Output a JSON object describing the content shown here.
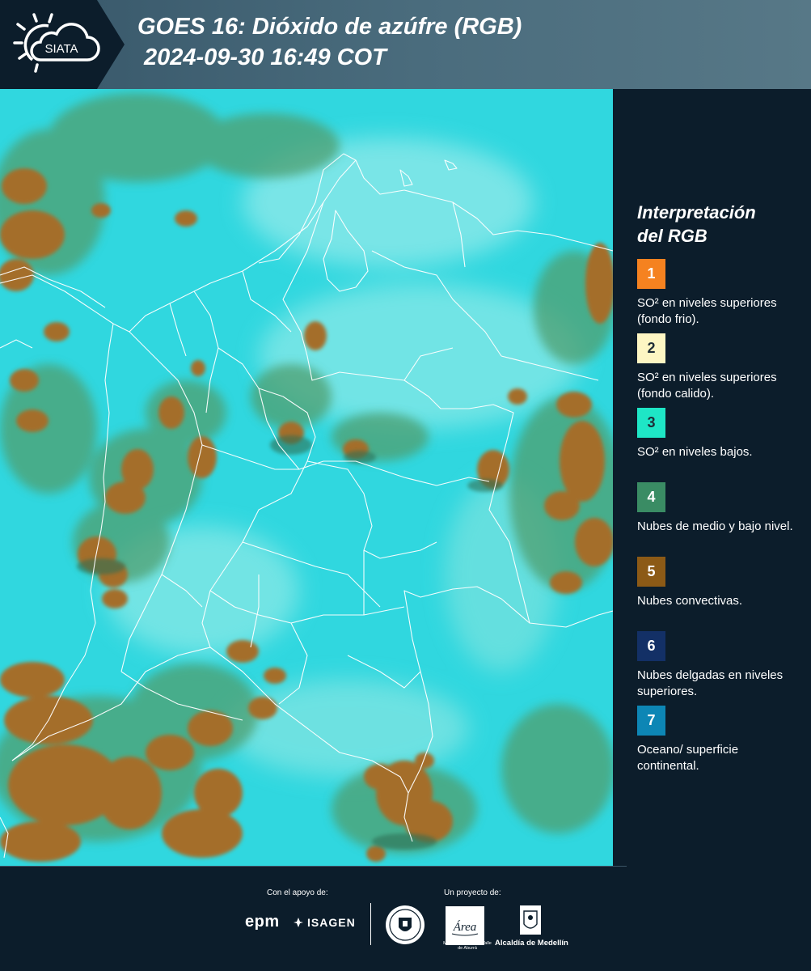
{
  "header": {
    "logo_text": "SIATA",
    "title_line1": "GOES 16: Dióxido de azúfre (RGB)",
    "title_line2": "2024-09-30 16:49 COT"
  },
  "map": {
    "product": "Dióxido de azúfre (RGB)",
    "background_color": "#2fd6de",
    "boundary_color": "#ffffff"
  },
  "legend": {
    "title_line1": "Interpretación",
    "title_line2": "del RGB",
    "items": [
      {
        "number": "1",
        "color": "#f58220",
        "text_color": "#ffffff",
        "description": "SO² en niveles superiores (fondo frio)."
      },
      {
        "number": "2",
        "color": "#fdf6c3",
        "text_color": "#1f2d37",
        "description": "SO² en niveles superiores (fondo calido)."
      },
      {
        "number": "3",
        "color": "#1ee6c6",
        "text_color": "#1f2d37",
        "description": "SO² en niveles bajos."
      },
      {
        "number": "4",
        "color": "#3a8c64",
        "text_color": "#ffffff",
        "description": "Nubes de medio y bajo nivel."
      },
      {
        "number": "5",
        "color": "#8c5a16",
        "text_color": "#ffffff",
        "description": "Nubes convectivas."
      },
      {
        "number": "6",
        "color": "#133066",
        "text_color": "#ffffff",
        "description": "Nubes delgadas en niveles superiores."
      },
      {
        "number": "7",
        "color": "#0d86b5",
        "text_color": "#ffffff",
        "description": "Oceano/ superficie continental."
      }
    ]
  },
  "footer": {
    "support_label": "Con el apoyo de:",
    "project_label": "Un proyecto de:",
    "sponsor1": "epm",
    "sponsor2": "ISAGEN",
    "partner_area": "Área",
    "partner_area_sub": "METROPOLITANA Valle de Aburrá",
    "partner_alcaldia": "Alcaldía de Medellín"
  }
}
